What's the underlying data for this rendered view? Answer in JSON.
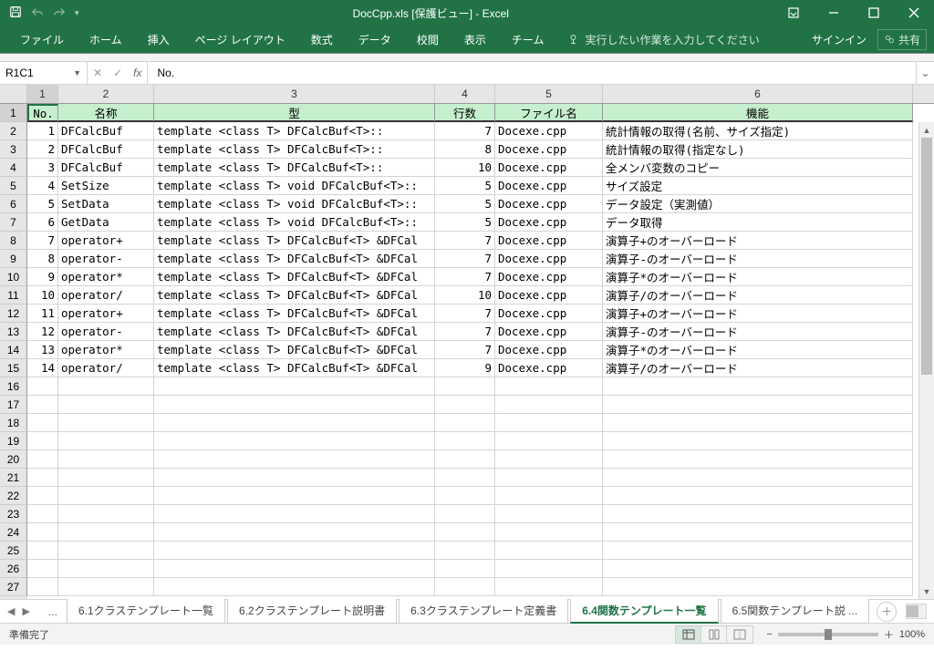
{
  "title": "DocCpp.xls [保護ビュー] - Excel",
  "qat": {
    "save": "保存",
    "undo": "元に戻す",
    "redo": "やり直し"
  },
  "ribbon": {
    "tabs": [
      "ファイル",
      "ホーム",
      "挿入",
      "ページ レイアウト",
      "数式",
      "データ",
      "校閲",
      "表示",
      "チーム"
    ],
    "tellme": "実行したい作業を入力してください",
    "signin": "サインイン",
    "share": "共有"
  },
  "namebox": "R1C1",
  "formula": "No.",
  "columns": [
    "1",
    "2",
    "3",
    "4",
    "5",
    "6"
  ],
  "headers": [
    "No.",
    "名称",
    "型",
    "行数",
    "ファイル名",
    "機能"
  ],
  "rows": [
    {
      "no": "1",
      "name": "DFCalcBuf",
      "type": "template <class T> DFCalcBuf<T>::",
      "lines": "7",
      "file": "Docexe.cpp",
      "func": "統計情報の取得(名前、サイズ指定)"
    },
    {
      "no": "2",
      "name": "DFCalcBuf",
      "type": "template <class T> DFCalcBuf<T>::",
      "lines": "8",
      "file": "Docexe.cpp",
      "func": "統計情報の取得(指定なし)"
    },
    {
      "no": "3",
      "name": "DFCalcBuf",
      "type": "template <class T> DFCalcBuf<T>::",
      "lines": "10",
      "file": "Docexe.cpp",
      "func": "全メンバ変数のコピー"
    },
    {
      "no": "4",
      "name": "SetSize",
      "type": "template <class T> void DFCalcBuf<T>::",
      "lines": "5",
      "file": "Docexe.cpp",
      "func": "サイズ設定"
    },
    {
      "no": "5",
      "name": "SetData",
      "type": "template <class T> void DFCalcBuf<T>::",
      "lines": "5",
      "file": "Docexe.cpp",
      "func": "データ設定（実測値）"
    },
    {
      "no": "6",
      "name": "GetData",
      "type": "template <class T> void DFCalcBuf<T>::",
      "lines": "5",
      "file": "Docexe.cpp",
      "func": "データ取得"
    },
    {
      "no": "7",
      "name": "operator+",
      "type": "template <class T> DFCalcBuf<T> &DFCal",
      "lines": "7",
      "file": "Docexe.cpp",
      "func": "演算子+のオーバーロード"
    },
    {
      "no": "8",
      "name": "operator-",
      "type": "template <class T> DFCalcBuf<T> &DFCal",
      "lines": "7",
      "file": "Docexe.cpp",
      "func": "演算子-のオーバーロード"
    },
    {
      "no": "9",
      "name": "operator*",
      "type": "template <class T> DFCalcBuf<T> &DFCal",
      "lines": "7",
      "file": "Docexe.cpp",
      "func": "演算子*のオーバーロード"
    },
    {
      "no": "10",
      "name": "operator/",
      "type": "template <class T> DFCalcBuf<T> &DFCal",
      "lines": "10",
      "file": "Docexe.cpp",
      "func": "演算子/のオーバーロード"
    },
    {
      "no": "11",
      "name": "operator+",
      "type": "template <class T> DFCalcBuf<T> &DFCal",
      "lines": "7",
      "file": "Docexe.cpp",
      "func": "演算子+のオーバーロード"
    },
    {
      "no": "12",
      "name": "operator-",
      "type": "template <class T> DFCalcBuf<T> &DFCal",
      "lines": "7",
      "file": "Docexe.cpp",
      "func": "演算子-のオーバーロード"
    },
    {
      "no": "13",
      "name": "operator*",
      "type": "template <class T> DFCalcBuf<T> &DFCal",
      "lines": "7",
      "file": "Docexe.cpp",
      "func": "演算子*のオーバーロード"
    },
    {
      "no": "14",
      "name": "operator/",
      "type": "template <class T> DFCalcBuf<T> &DFCal",
      "lines": "9",
      "file": "Docexe.cpp",
      "func": "演算子/のオーバーロード"
    }
  ],
  "empty_rows": 12,
  "sheets": {
    "ellipsis": "...",
    "tabs": [
      "6.1クラステンプレート一覧",
      "6.2クラステンプレート説明書",
      "6.3クラステンプレート定義書",
      "6.4関数テンプレート一覧",
      "6.5関数テンプレート説 ..."
    ],
    "active_index": 3
  },
  "status": {
    "ready": "準備完了",
    "zoom": "100%"
  }
}
